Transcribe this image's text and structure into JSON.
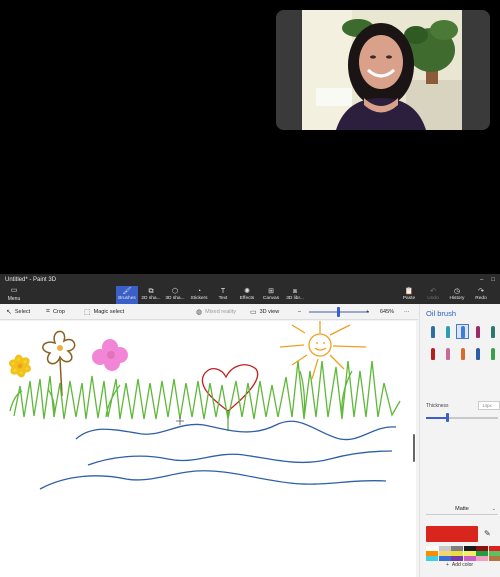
{
  "window": {
    "title": "Untitled* - Paint 3D",
    "controls": [
      "–",
      "□"
    ]
  },
  "ribbon": {
    "menu_label": "Menu",
    "tabs": [
      {
        "label": "Brushes",
        "icon": "brush-icon"
      },
      {
        "label": "2D sha...",
        "icon": "2d-shapes-icon"
      },
      {
        "label": "3D sha...",
        "icon": "3d-shapes-icon"
      },
      {
        "label": "Stickers",
        "icon": "sticker-icon"
      },
      {
        "label": "Text",
        "icon": "text-icon"
      },
      {
        "label": "Effects",
        "icon": "effects-icon"
      },
      {
        "label": "Canvas",
        "icon": "canvas-icon"
      },
      {
        "label": "3D libr...",
        "icon": "3d-library-icon"
      }
    ],
    "right": [
      {
        "label": "Paste",
        "icon": "paste-icon"
      },
      {
        "label": "Undo",
        "icon": "undo-icon"
      },
      {
        "label": "History",
        "icon": "history-icon"
      },
      {
        "label": "Redo",
        "icon": "redo-icon"
      }
    ]
  },
  "toolbar": {
    "select": "Select",
    "crop": "Crop",
    "magic_select": "Magic select",
    "mixed_reality": "Mixed reality",
    "view_3d": "3D view",
    "zoom_minus": "–",
    "zoom_plus": "+",
    "zoom_value": "645%",
    "more": "···"
  },
  "panel": {
    "title": "Oil brush",
    "thickness_label": "Thickness",
    "thickness_value": "14px",
    "finish": "Matte",
    "add_color": "Add color",
    "current_color": "#d8261f",
    "brushes": [
      {
        "name": "marker",
        "color": "#2f6f9f"
      },
      {
        "name": "calligraphy-pen",
        "color": "#2b9fb0"
      },
      {
        "name": "oil-brush",
        "color": "#3f7bd9"
      },
      {
        "name": "watercolor",
        "color": "#9c2a6a"
      },
      {
        "name": "pixel-pen",
        "color": "#2c7a6e"
      },
      {
        "name": "pencil",
        "color": "#b22020"
      },
      {
        "name": "eraser",
        "color": "#c86a9a"
      },
      {
        "name": "crayon",
        "color": "#d96a2a"
      },
      {
        "name": "spray-can",
        "color": "#2a5fa8"
      },
      {
        "name": "fill",
        "color": "#3aa04a"
      }
    ],
    "palette": [
      "#ffffff",
      "#c8c8c8",
      "#7f7f7f",
      "#1a1a1a",
      "#8b1010",
      "#e02020",
      "#ff8c00",
      "#f5d76e",
      "#e8e040",
      "#f0f060",
      "#1e9e3e",
      "#60c060",
      "#40d0e0",
      "#3a6fd8",
      "#7a3aa8",
      "#c860c8",
      "#f0a0c0",
      "#b07840"
    ]
  }
}
